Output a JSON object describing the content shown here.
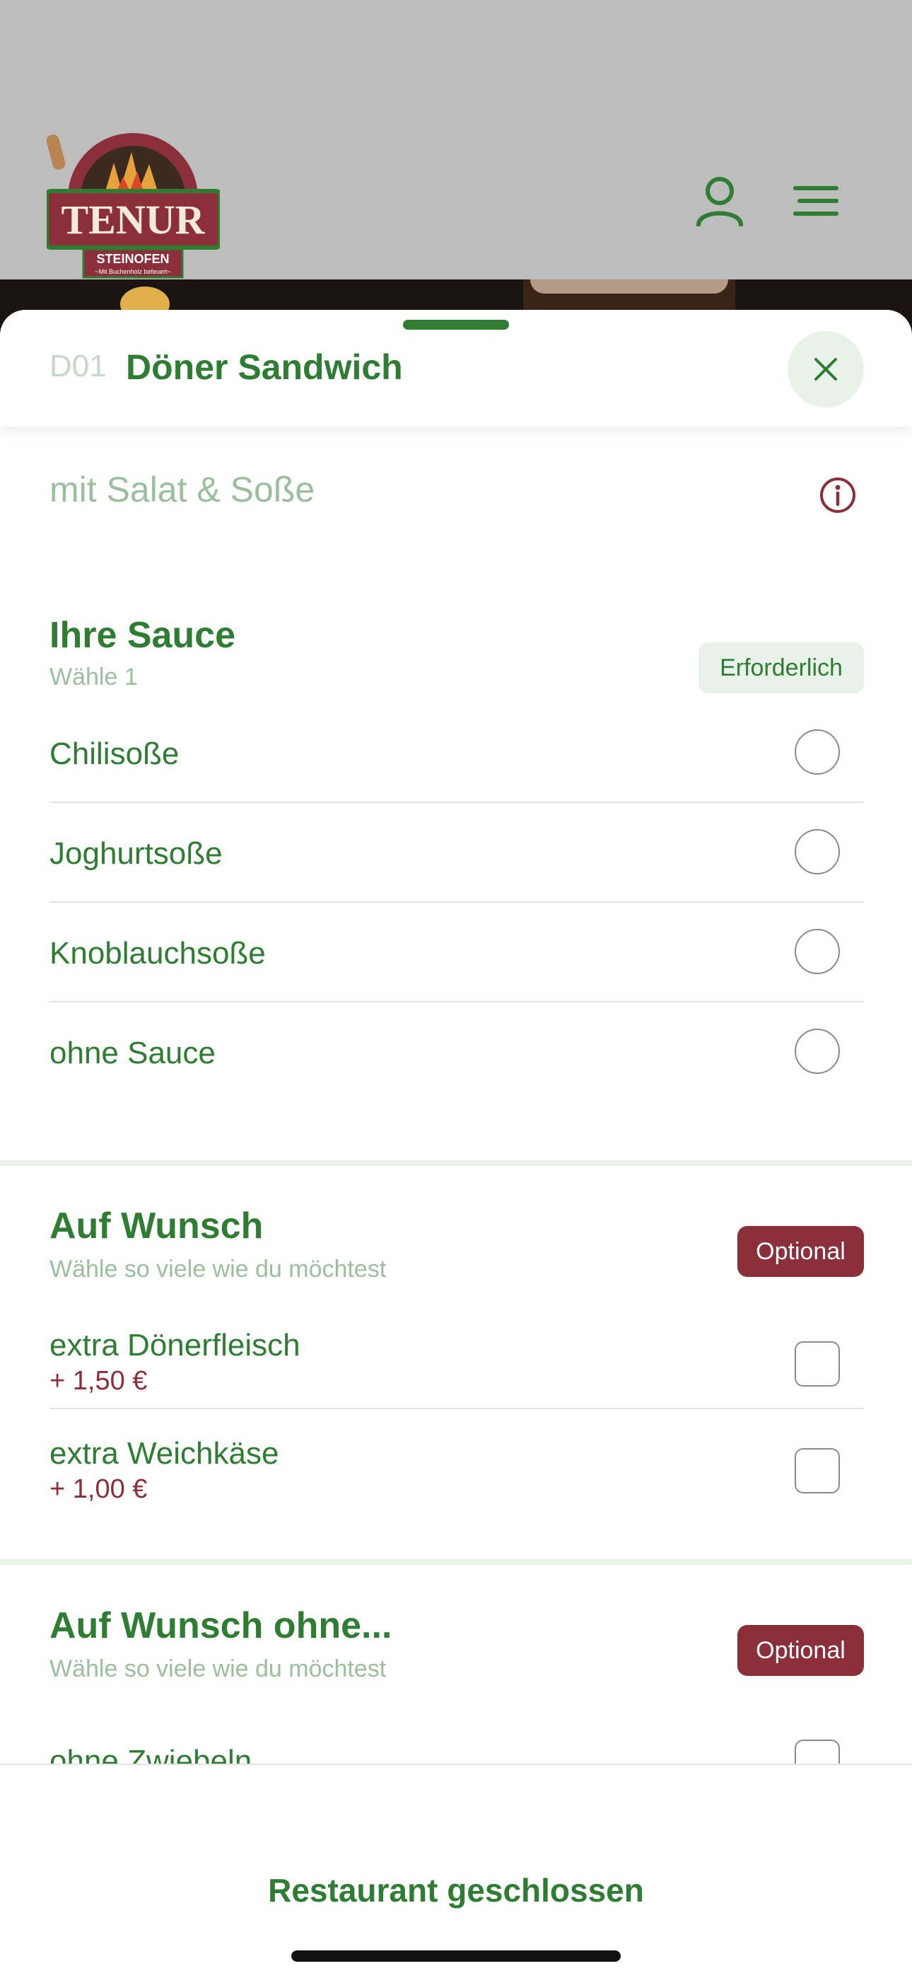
{
  "brand": {
    "logo_text": "TENUR",
    "logo_sub": "STEINOFEN",
    "logo_tag": "~Mit Buchenholz befeuert~"
  },
  "header": {
    "user_icon": "user-icon",
    "menu_icon": "hamburger-menu-icon"
  },
  "item": {
    "code": "D01",
    "title": "Döner Sandwich",
    "description": "mit Salat & Soße"
  },
  "sections": [
    {
      "title": "Ihre Sauce",
      "subtitle": "Wähle 1",
      "badge": "Erforderlich",
      "options": [
        {
          "label": "Chilisoße"
        },
        {
          "label": "Joghurtsoße"
        },
        {
          "label": "Knoblauchsoße"
        },
        {
          "label": "ohne Sauce"
        }
      ]
    },
    {
      "title": "Auf Wunsch",
      "subtitle": "Wähle so viele wie du möchtest",
      "badge": "Optional",
      "options": [
        {
          "label": "extra Dönerfleisch",
          "price": "+ 1,50 €"
        },
        {
          "label": "extra Weichkäse",
          "price": "+ 1,00 €"
        }
      ]
    },
    {
      "title": "Auf Wunsch ohne...",
      "subtitle": "Wähle so viele wie du möchtest",
      "badge": "Optional",
      "options": [
        {
          "label": "ohne Zwiebeln"
        }
      ]
    }
  ],
  "footer": {
    "status": "Restaurant geschlossen"
  },
  "colors": {
    "primary_green": "#2e7d32",
    "light_green": "#e8f2e8",
    "accent_red": "#8b2f3a"
  }
}
